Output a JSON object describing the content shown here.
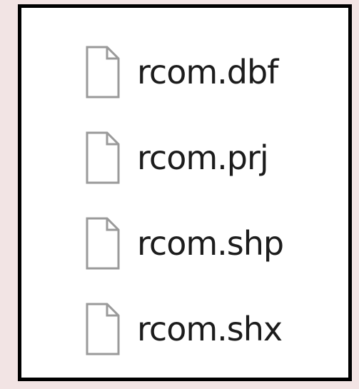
{
  "files": [
    {
      "name": "rcom.dbf",
      "icon": "generic-file-icon"
    },
    {
      "name": "rcom.prj",
      "icon": "generic-file-icon"
    },
    {
      "name": "rcom.shp",
      "icon": "generic-file-icon"
    },
    {
      "name": "rcom.shx",
      "icon": "generic-file-icon"
    }
  ],
  "colors": {
    "background": "#f2e4e4",
    "panel": "#ffffff",
    "border": "#000000",
    "icon_stroke": "#9a9a9a",
    "text": "#1c1c1c"
  }
}
